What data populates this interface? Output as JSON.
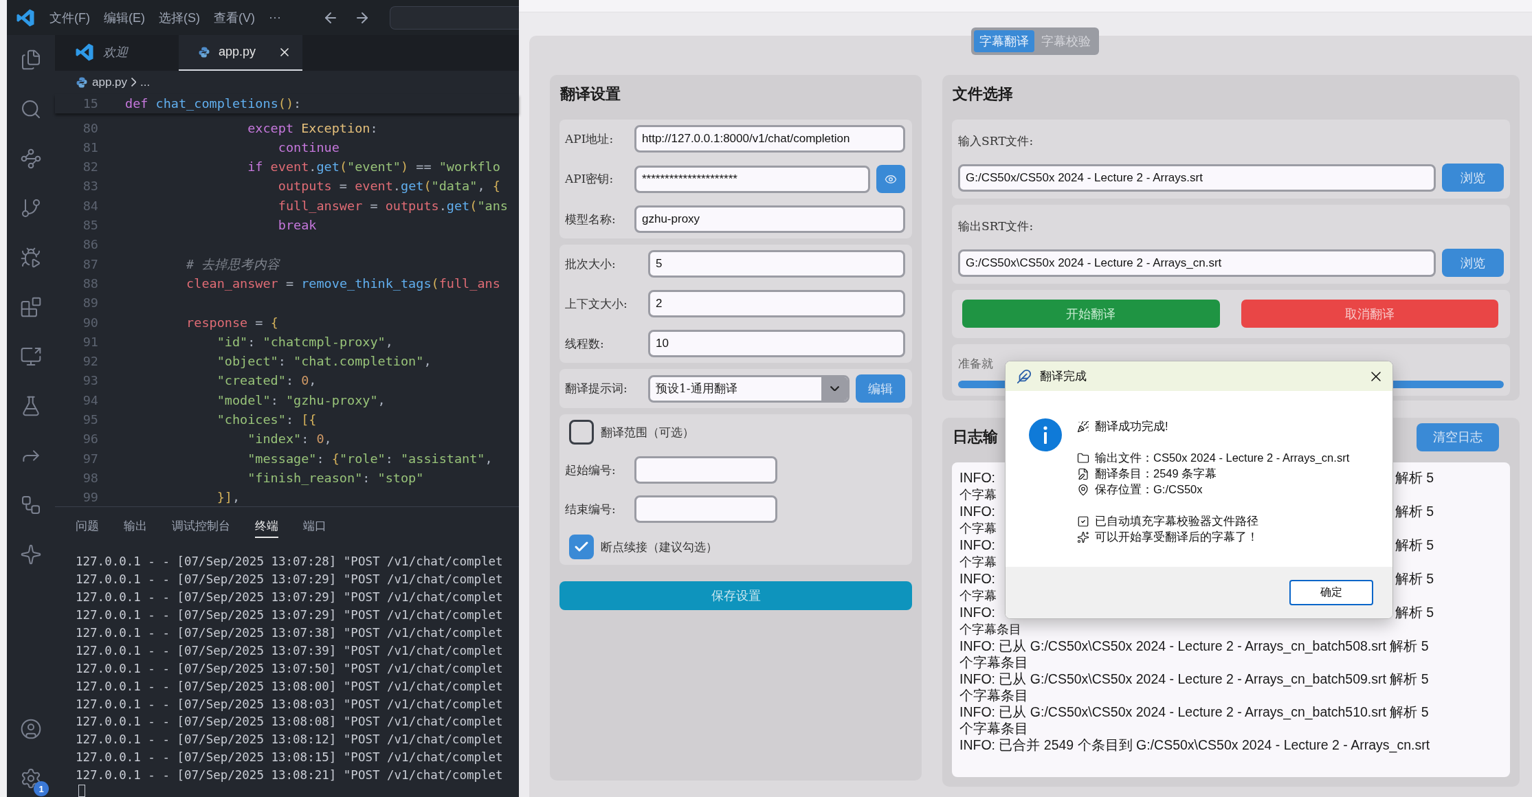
{
  "vscode": {
    "menu": [
      "文件(F)",
      "编辑(E)",
      "选择(S)",
      "查看(V)"
    ],
    "more": "···",
    "tabs": [
      {
        "label": "欢迎",
        "kind": "welcome",
        "selected": false
      },
      {
        "label": "app.py",
        "kind": "python",
        "selected": true
      }
    ],
    "breadcrumb": {
      "file": "app.py",
      "rest": "..."
    },
    "sticky": {
      "number": "15",
      "tokens": [
        {
          "kind": "kw",
          "text": "def"
        },
        {
          "kind": "fn",
          "text": " chat_completions"
        },
        {
          "kind": "br",
          "text": "()"
        },
        {
          "kind": "p",
          "text": ":"
        }
      ]
    },
    "lines": [
      {
        "number": "80",
        "tokens": [
          {
            "kind": "kw",
            "text": "                except"
          },
          {
            "kind": "cls",
            "text": " Exception"
          },
          {
            "kind": "p",
            "text": ":"
          }
        ]
      },
      {
        "number": "81",
        "tokens": [
          {
            "kind": "kw",
            "text": "                    continue"
          }
        ]
      },
      {
        "number": "82",
        "tokens": [
          {
            "kind": "kw",
            "text": "                if"
          },
          {
            "kind": "var",
            "text": " event"
          },
          {
            "kind": "p",
            "text": "."
          },
          {
            "kind": "fn",
            "text": "get"
          },
          {
            "kind": "br",
            "text": "("
          },
          {
            "kind": "str",
            "text": "\"event\""
          },
          {
            "kind": "br",
            "text": ")"
          },
          {
            "kind": "p",
            "text": " == "
          },
          {
            "kind": "str",
            "text": "\"workflo"
          }
        ]
      },
      {
        "number": "83",
        "tokens": [
          {
            "kind": "var",
            "text": "                    outputs"
          },
          {
            "kind": "p",
            "text": " = "
          },
          {
            "kind": "var",
            "text": "event"
          },
          {
            "kind": "p",
            "text": "."
          },
          {
            "kind": "fn",
            "text": "get"
          },
          {
            "kind": "br",
            "text": "("
          },
          {
            "kind": "str",
            "text": "\"data\""
          },
          {
            "kind": "p",
            "text": ", "
          },
          {
            "kind": "br",
            "text": "{"
          }
        ]
      },
      {
        "number": "84",
        "tokens": [
          {
            "kind": "var",
            "text": "                    full_answer"
          },
          {
            "kind": "p",
            "text": " = "
          },
          {
            "kind": "var",
            "text": "outputs"
          },
          {
            "kind": "p",
            "text": "."
          },
          {
            "kind": "fn",
            "text": "get"
          },
          {
            "kind": "br",
            "text": "("
          },
          {
            "kind": "str",
            "text": "\"ans"
          }
        ]
      },
      {
        "number": "85",
        "tokens": [
          {
            "kind": "kw",
            "text": "                    break"
          }
        ]
      },
      {
        "number": "86"
      },
      {
        "number": "87",
        "tokens": [
          {
            "kind": "com",
            "text": "        # 去掉思考内容"
          }
        ]
      },
      {
        "number": "88",
        "tokens": [
          {
            "kind": "var",
            "text": "        clean_answer"
          },
          {
            "kind": "p",
            "text": " = "
          },
          {
            "kind": "fn",
            "text": "remove_think_tags"
          },
          {
            "kind": "br",
            "text": "("
          },
          {
            "kind": "var",
            "text": "full_ans"
          }
        ]
      },
      {
        "number": "89"
      },
      {
        "number": "90",
        "tokens": [
          {
            "kind": "var",
            "text": "        response"
          },
          {
            "kind": "p",
            "text": " = "
          },
          {
            "kind": "br",
            "text": "{"
          }
        ]
      },
      {
        "number": "91",
        "tokens": [
          {
            "kind": "str",
            "text": "            \"id\""
          },
          {
            "kind": "p",
            "text": ": "
          },
          {
            "kind": "str",
            "text": "\"chatcmpl-proxy\""
          },
          {
            "kind": "p",
            "text": ","
          }
        ]
      },
      {
        "number": "92",
        "tokens": [
          {
            "kind": "str",
            "text": "            \"object\""
          },
          {
            "kind": "p",
            "text": ": "
          },
          {
            "kind": "str",
            "text": "\"chat.completion\""
          },
          {
            "kind": "p",
            "text": ","
          }
        ]
      },
      {
        "number": "93",
        "tokens": [
          {
            "kind": "str",
            "text": "            \"created\""
          },
          {
            "kind": "p",
            "text": ": "
          },
          {
            "kind": "num",
            "text": "0"
          },
          {
            "kind": "p",
            "text": ","
          }
        ]
      },
      {
        "number": "94",
        "tokens": [
          {
            "kind": "str",
            "text": "            \"model\""
          },
          {
            "kind": "p",
            "text": ": "
          },
          {
            "kind": "str",
            "text": "\"gzhu-proxy\""
          },
          {
            "kind": "p",
            "text": ","
          }
        ]
      },
      {
        "number": "95",
        "tokens": [
          {
            "kind": "str",
            "text": "            \"choices\""
          },
          {
            "kind": "p",
            "text": ": "
          },
          {
            "kind": "br",
            "text": "[{"
          }
        ]
      },
      {
        "number": "96",
        "tokens": [
          {
            "kind": "str",
            "text": "                \"index\""
          },
          {
            "kind": "p",
            "text": ": "
          },
          {
            "kind": "num",
            "text": "0"
          },
          {
            "kind": "p",
            "text": ","
          }
        ]
      },
      {
        "number": "97",
        "tokens": [
          {
            "kind": "str",
            "text": "                \"message\""
          },
          {
            "kind": "p",
            "text": ": "
          },
          {
            "kind": "br",
            "text": "{"
          },
          {
            "kind": "str",
            "text": "\"role\""
          },
          {
            "kind": "p",
            "text": ": "
          },
          {
            "kind": "str",
            "text": "\"assistant\""
          },
          {
            "kind": "p",
            "text": ","
          }
        ]
      },
      {
        "number": "98",
        "tokens": [
          {
            "kind": "str",
            "text": "                \"finish_reason\""
          },
          {
            "kind": "p",
            "text": ": "
          },
          {
            "kind": "str",
            "text": "\"stop\""
          }
        ]
      },
      {
        "number": "99",
        "tokens": [
          {
            "kind": "br",
            "text": "            }]"
          },
          {
            "kind": "p",
            "text": ","
          }
        ]
      }
    ],
    "panel_tabs": [
      {
        "label": "问题",
        "selected": false
      },
      {
        "label": "输出",
        "selected": false
      },
      {
        "label": "调试控制台",
        "selected": false
      },
      {
        "label": "终端",
        "selected": true
      },
      {
        "label": "端口",
        "selected": false
      }
    ],
    "terminal": [
      "127.0.0.1 - - [07/Sep/2025 13:07:28] \"POST /v1/chat/complet",
      "127.0.0.1 - - [07/Sep/2025 13:07:29] \"POST /v1/chat/complet",
      "127.0.0.1 - - [07/Sep/2025 13:07:29] \"POST /v1/chat/complet",
      "127.0.0.1 - - [07/Sep/2025 13:07:29] \"POST /v1/chat/complet",
      "127.0.0.1 - - [07/Sep/2025 13:07:38] \"POST /v1/chat/complet",
      "127.0.0.1 - - [07/Sep/2025 13:07:39] \"POST /v1/chat/complet",
      "127.0.0.1 - - [07/Sep/2025 13:07:50] \"POST /v1/chat/complet",
      "127.0.0.1 - - [07/Sep/2025 13:08:00] \"POST /v1/chat/complet",
      "127.0.0.1 - - [07/Sep/2025 13:08:03] \"POST /v1/chat/complet",
      "127.0.0.1 - - [07/Sep/2025 13:08:08] \"POST /v1/chat/complet",
      "127.0.0.1 - - [07/Sep/2025 13:08:12] \"POST /v1/chat/complet",
      "127.0.0.1 - - [07/Sep/2025 13:08:15] \"POST /v1/chat/complet",
      "127.0.0.1 - - [07/Sep/2025 13:08:21] \"POST /v1/chat/complet"
    ],
    "settings_badge": "1"
  },
  "app": {
    "mode_tabs": [
      {
        "label": "字幕翻译",
        "selected": true
      },
      {
        "label": "字幕校验",
        "selected": false
      }
    ],
    "settings": {
      "title": "翻译设置",
      "api": [
        {
          "label": "API地址:",
          "value": "http://127.0.0.1:8000/v1/chat/completion",
          "kind": "text"
        },
        {
          "label": "API密钥:",
          "value": "*********************",
          "kind": "secret"
        },
        {
          "label": "模型名称:",
          "value": "gzhu-proxy",
          "kind": "text"
        }
      ],
      "numbers": [
        {
          "label": "批次大小:",
          "value": "5"
        },
        {
          "label": "上下文大小:",
          "value": "2"
        },
        {
          "label": "线程数:",
          "value": "10"
        }
      ],
      "prompt": {
        "label": "翻译提示词:",
        "value": "预设1-通用翻译",
        "button": "编辑"
      },
      "range_toggle": {
        "label": "翻译范围（可选）",
        "checked": false
      },
      "range_fields": [
        {
          "label": "起始编号:"
        },
        {
          "label": "结束编号:"
        }
      ],
      "resume": {
        "label": "断点续接（建议勾选）",
        "checked": true
      },
      "save": "保存设置"
    },
    "files": {
      "title": "文件选择",
      "inputs": [
        {
          "label": "输入SRT文件:",
          "value": "G:/CS50x/CS50x 2024 - Lecture 2 - Arrays.srt",
          "button": "浏览"
        },
        {
          "label": "输出SRT文件:",
          "value": "G:/CS50x\\CS50x 2024 - Lecture 2 - Arrays_cn.srt",
          "button": "浏览"
        }
      ],
      "actions": [
        {
          "label": "开始翻译",
          "kind": "start"
        },
        {
          "label": "取消翻译",
          "kind": "cancel"
        }
      ],
      "progress": {
        "label": "准备就",
        "level": 1
      }
    },
    "log": {
      "title": "日志输",
      "clear": "清空日志",
      "entries": [
        {
          "kind": "covered",
          "start": "INFO:",
          "end": "解析 5",
          "wrap": "个字幕"
        },
        {
          "kind": "covered",
          "start": "INFO:",
          "end": "解析 5",
          "wrap": "个字幕"
        },
        {
          "kind": "covered",
          "start": "INFO:",
          "end": "解析 5",
          "wrap": "个字幕"
        },
        {
          "kind": "covered",
          "start": "INFO:",
          "end": "解析 5",
          "wrap": "个字幕"
        },
        {
          "kind": "covered",
          "start": "INFO:",
          "end": "解析 5",
          "wrap": "个字幕条目"
        },
        {
          "kind": "full",
          "text": "INFO: 已从 G:/CS50x\\CS50x 2024 - Lecture 2 - Arrays_cn_batch508.srt 解析 5 个字幕条目"
        },
        {
          "kind": "full",
          "text": "INFO: 已从 G:/CS50x\\CS50x 2024 - Lecture 2 - Arrays_cn_batch509.srt 解析 5 个字幕条目"
        },
        {
          "kind": "full",
          "text": "INFO: 已从 G:/CS50x\\CS50x 2024 - Lecture 2 - Arrays_cn_batch510.srt 解析 5 个字幕条目"
        },
        {
          "kind": "full",
          "text": "INFO: 已合并 2549 个条目到 G:/CS50x\\CS50x 2024 - Lecture 2 - Arrays_cn.srt"
        }
      ]
    },
    "dialog": {
      "title": "翻译完成",
      "groups": [
        [
          {
            "kind": "party",
            "text": "翻译成功完成!"
          }
        ],
        [
          {
            "kind": "folder",
            "text": "输出文件：CS50x 2024 - Lecture 2 - Arrays_cn.srt"
          },
          {
            "kind": "file",
            "text": "翻译条目：2549 条字幕"
          },
          {
            "kind": "pin",
            "text": "保存位置：G:/CS50x"
          }
        ],
        [
          {
            "kind": "check",
            "text": "已自动填充字幕校验器文件路径"
          },
          {
            "kind": "sparkles",
            "text": "可以开始享受翻译后的字幕了！"
          }
        ]
      ],
      "ok": "确定"
    }
  }
}
